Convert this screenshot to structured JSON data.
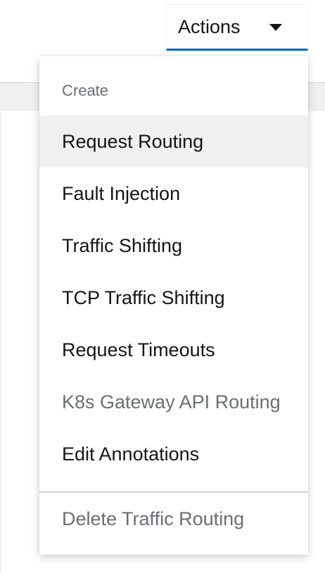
{
  "toolbar": {
    "actions_label": "Actions"
  },
  "menu": {
    "group_title": "Create",
    "items": [
      {
        "label": "Request Routing",
        "state": "hover"
      },
      {
        "label": "Fault Injection",
        "state": "enabled"
      },
      {
        "label": "Traffic Shifting",
        "state": "enabled"
      },
      {
        "label": "TCP Traffic Shifting",
        "state": "enabled"
      },
      {
        "label": "Request Timeouts",
        "state": "enabled"
      },
      {
        "label": "K8s Gateway API Routing",
        "state": "disabled"
      },
      {
        "label": "Edit Annotations",
        "state": "enabled"
      }
    ],
    "delete_label": "Delete Traffic Routing"
  },
  "icons": {
    "toggle_caret": "caret-down-icon"
  },
  "colors": {
    "accent": "#0066cc",
    "text": "#151515",
    "muted_text": "#6a6e73",
    "hover_bg": "#f0f0f0",
    "divider": "#d2d2d2"
  }
}
